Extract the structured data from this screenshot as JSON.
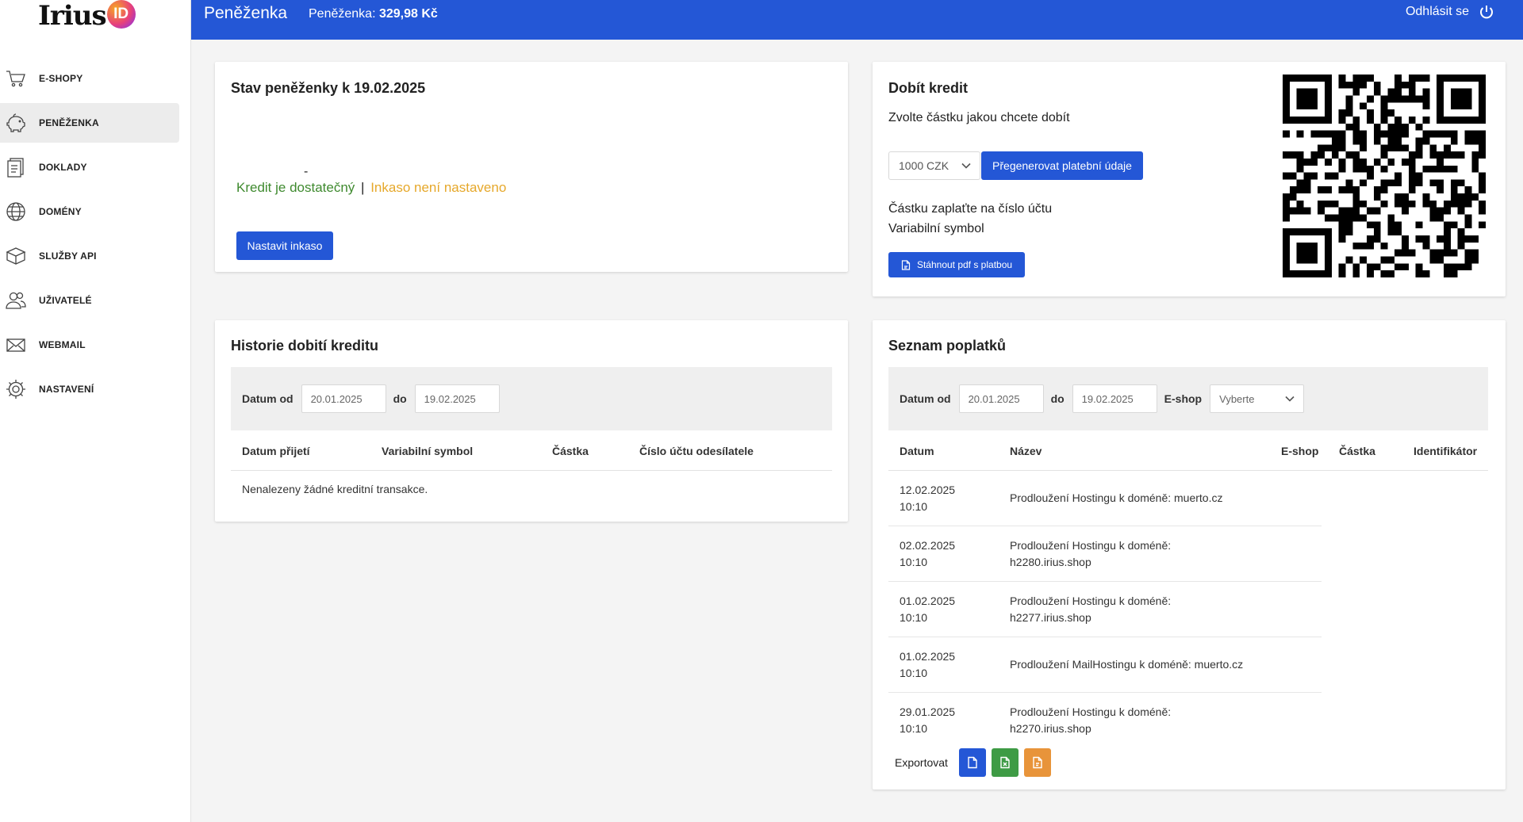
{
  "brand": {
    "logo_text": "Irius",
    "logo_badge": "ID"
  },
  "sidebar": {
    "items": [
      {
        "label": "E-SHOPY",
        "icon": "cart-icon"
      },
      {
        "label": "PENĚŽENKA",
        "icon": "piggy-bank-icon",
        "active": true
      },
      {
        "label": "DOKLADY",
        "icon": "documents-icon"
      },
      {
        "label": "DOMÉNY",
        "icon": "globe-icon"
      },
      {
        "label": "SLUŽBY API",
        "icon": "box-icon"
      },
      {
        "label": "UŽIVATELÉ",
        "icon": "users-icon"
      },
      {
        "label": "WEBMAIL",
        "icon": "envelope-icon"
      },
      {
        "label": "NASTAVENÍ",
        "icon": "gear-icon"
      }
    ]
  },
  "topbar": {
    "title": "Peněženka",
    "balance_label": "Peněženka:",
    "balance_value": "329,98 Kč",
    "logout_label": "Odhlásit se",
    "color": "#2457d6"
  },
  "wallet_state": {
    "title": "Stav peněženky k 19.02.2025",
    "credit_ok": "Kredit je dostatečný",
    "separator": "|",
    "inkaso_status": "Inkaso není nastaveno",
    "button_label": "Nastavit inkaso",
    "marker": "-"
  },
  "topup": {
    "title": "Dobít kredit",
    "subtitle": "Zvolte částku jakou chcete dobít",
    "amount_selected": "1000 CZK",
    "regen_label": "Přegenerovat platební údaje",
    "pay_line1": "Částku zaplaťte na číslo účtu",
    "pay_line2": "Variabilní symbol",
    "pdf_label": "Stáhnout pdf s platbou"
  },
  "history": {
    "title": "Historie dobití kreditu",
    "filter": {
      "from_label": "Datum od",
      "from_value": "20.01.2025",
      "to_label": "do",
      "to_value": "19.02.2025"
    },
    "columns": [
      "Datum přijetí",
      "Variabilní symbol",
      "Částka",
      "Číslo účtu odesílatele"
    ],
    "empty_message": "Nenalezeny žádné kreditní transakce."
  },
  "fees": {
    "title": "Seznam poplatků",
    "filter": {
      "from_label": "Datum od",
      "from_value": "20.01.2025",
      "to_label": "do",
      "to_value": "19.02.2025",
      "eshop_label": "E-shop",
      "eshop_placeholder": "Vyberte"
    },
    "columns": [
      "Datum",
      "Název",
      "E-shop",
      "Částka",
      "Identifikátor"
    ],
    "rows": [
      {
        "date": "12.02.2025",
        "time": "10:10",
        "name": "Prodloužení Hostingu k doméně: muerto.cz"
      },
      {
        "date": "02.02.2025",
        "time": "10:10",
        "name": "Prodloužení Hostingu k doméně: h2280.irius.shop"
      },
      {
        "date": "01.02.2025",
        "time": "10:10",
        "name": "Prodloužení Hostingu k doméně: h2277.irius.shop"
      },
      {
        "date": "01.02.2025",
        "time": "10:10",
        "name": "Prodloužení MailHostingu k doméně: muerto.cz"
      },
      {
        "date": "29.01.2025",
        "time": "10:10",
        "name": "Prodloužení Hostingu k doméně: h2270.irius.shop"
      }
    ],
    "export_label": "Exportovat",
    "export_colors": [
      "#2457d6",
      "#3e9b45",
      "#e8943a"
    ]
  }
}
